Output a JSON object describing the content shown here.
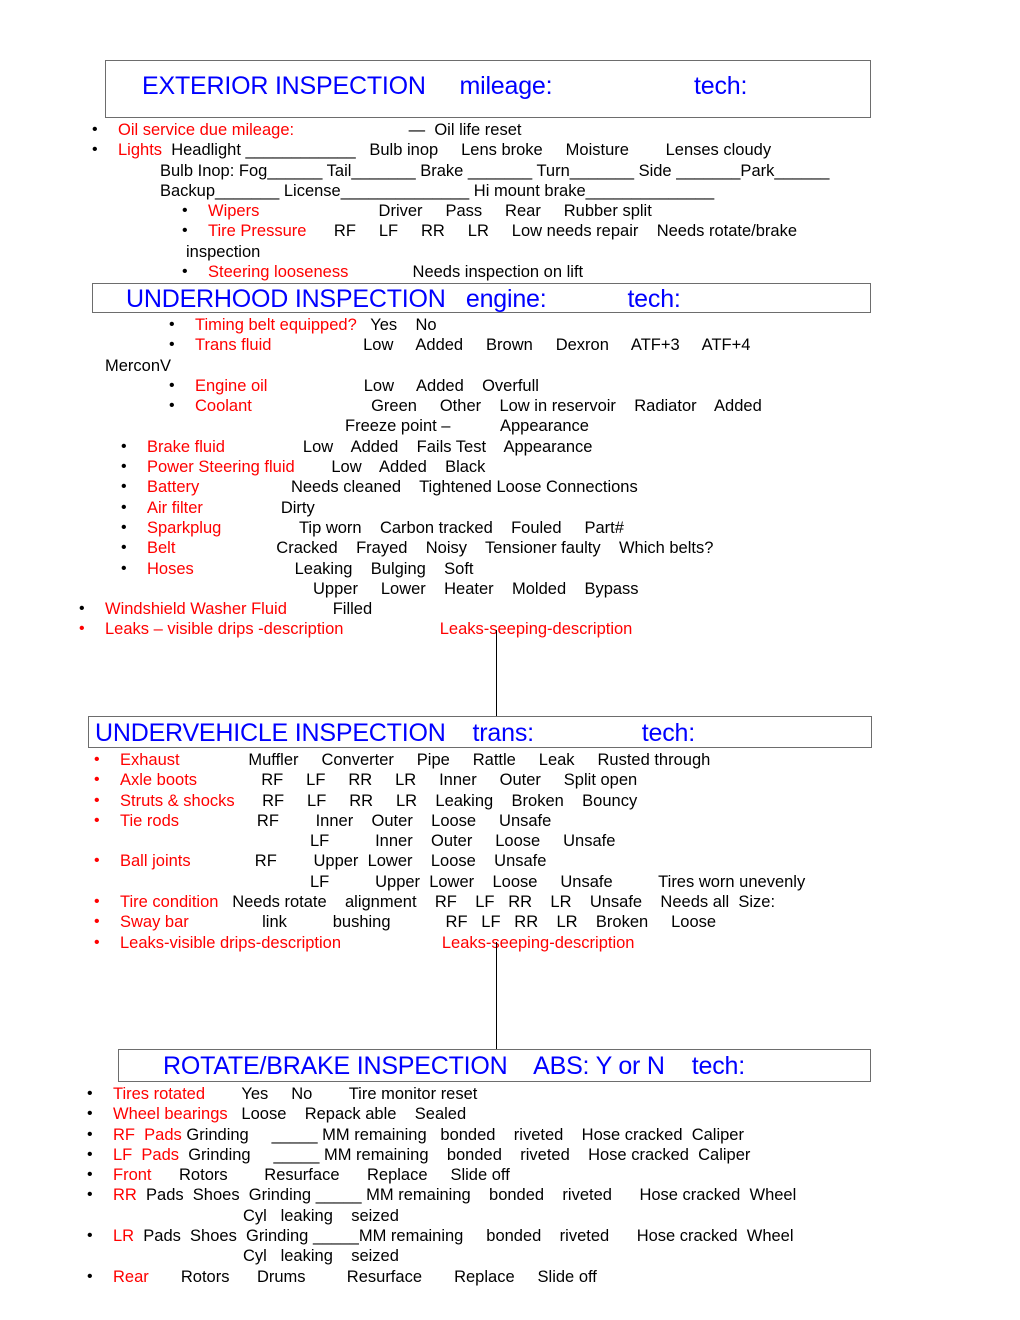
{
  "document": {
    "title": "Vehicle Inspection Checklist",
    "colors": {
      "heading": "#0000FF",
      "label": "#FF0000",
      "body": "#000000",
      "box_border": "#6D6D6D"
    }
  },
  "sections": [
    {
      "id": "exterior",
      "heading": "EXTERIOR INSPECTION     mileage:                     tech:",
      "heading_parts": {
        "name": "EXTERIOR INSPECTION",
        "field1_label": "mileage:",
        "field2_label": "tech:"
      },
      "lines": [
        {
          "bullet": "black",
          "indent": 0,
          "label": "Oil service due mileage:",
          "text": "                         —  Oil life reset"
        },
        {
          "bullet": "black",
          "indent": 0,
          "label": "Lights",
          "text": "  Headlight ____________   Bulb inop     Lens broke     Moisture        Lenses cloudy"
        },
        {
          "bullet": "none",
          "indent": 1,
          "label": "",
          "text": "Bulb Inop: Fog______ Tail_______ Brake _______ Turn_______ Side _______Park______"
        },
        {
          "bullet": "none",
          "indent": 1,
          "label": "",
          "text": "Backup_______ License______________ Hi mount brake______________"
        },
        {
          "bullet": "black",
          "indent": 2,
          "label": "Wipers",
          "text": "                          Driver     Pass     Rear     Rubber split"
        },
        {
          "bullet": "black",
          "indent": 2,
          "label": "Tire Pressure",
          "text": "      RF     LF     RR     LR     Low needs repair    Needs rotate/brake"
        },
        {
          "bullet": "none",
          "indent": 3,
          "label": "",
          "text": "inspection"
        },
        {
          "bullet": "black",
          "indent": 2,
          "label": "Steering looseness",
          "text": "              Needs inspection on lift"
        }
      ]
    },
    {
      "id": "underhood",
      "heading": "UNDERHOOD INSPECTION   engine:            tech:",
      "heading_parts": {
        "name": "UNDERHOOD INSPECTION",
        "field1_label": "engine:",
        "field2_label": "tech:"
      },
      "lines": [
        {
          "bullet": "black",
          "indent": 2,
          "label": "Timing belt equipped?",
          "text": "   Yes    No"
        },
        {
          "bullet": "black",
          "indent": 2,
          "label": "Trans fluid",
          "text": "                    Low     Added     Brown     Dexron     ATF+3     ATF+4"
        },
        {
          "bullet": "none",
          "indent": 4,
          "label": "",
          "text": "MerconV"
        },
        {
          "bullet": "black",
          "indent": 2,
          "label": "Engine oil",
          "text": "                     Low     Added    Overfull"
        },
        {
          "bullet": "black",
          "indent": 2,
          "label": "Coolant",
          "text": "                          Green     Other    Low in reservoir    Radiator    Added"
        },
        {
          "bullet": "none",
          "indent": 5,
          "label": "",
          "text": "Freeze point –           Appearance"
        },
        {
          "bullet": "black",
          "indent": 1,
          "label": "Brake fluid",
          "text": "                 Low    Added    Fails Test    Appearance"
        },
        {
          "bullet": "black",
          "indent": 1,
          "label": "Power Steering fluid",
          "text": "        Low    Added    Black"
        },
        {
          "bullet": "black",
          "indent": 1,
          "label": "Battery",
          "text": "                    Needs cleaned    Tightened Loose Connections"
        },
        {
          "bullet": "black",
          "indent": 1,
          "label": "Air filter",
          "text": "                 Dirty"
        },
        {
          "bullet": "black",
          "indent": 1,
          "label": "Sparkplug",
          "text": "                 Tip worn    Carbon tracked    Fouled     Part#"
        },
        {
          "bullet": "black",
          "indent": 1,
          "label": "Belt",
          "text": "                      Cracked    Frayed    Noisy    Tensioner faulty    Which belts?"
        },
        {
          "bullet": "black",
          "indent": 1,
          "label": "Hoses",
          "text": "                      Leaking    Bulging    Soft"
        },
        {
          "bullet": "none",
          "indent": 6,
          "label": "",
          "text": "Upper     Lower    Heater    Molded    Bypass"
        },
        {
          "bullet": "black",
          "indent": 0,
          "label": "Windshield Washer Fluid",
          "text": "          Filled"
        },
        {
          "bullet": "red",
          "indent": 0,
          "label": "Leaks – visible drips -description",
          "text": "",
          "label2": "Leaks-seeping-description",
          "label2_pad": "                     "
        }
      ]
    },
    {
      "id": "undervehicle",
      "heading": "UNDERVEHICLE INSPECTION    trans:                tech:",
      "heading_parts": {
        "name": "UNDERVEHICLE INSPECTION",
        "field1_label": "trans:",
        "field2_label": "tech:"
      },
      "lines": [
        {
          "bullet": "red",
          "indent": 0,
          "label": "Exhaust",
          "text": "               Muffler     Converter     Pipe     Rattle     Leak     Rusted through"
        },
        {
          "bullet": "red",
          "indent": 0,
          "label": "Axle boots",
          "text": "              RF     LF     RR     LR     Inner     Outer     Split open"
        },
        {
          "bullet": "red",
          "indent": 0,
          "label": "Struts & shocks",
          "text": "      RF     LF     RR     LR    Leaking    Broken    Bouncy"
        },
        {
          "bullet": "red",
          "indent": 0,
          "label": "Tie rods",
          "text": "                 RF        Inner    Outer    Loose     Unsafe"
        },
        {
          "bullet": "none",
          "indent": 7,
          "label": "",
          "text": "LF          Inner    Outer     Loose     Unsafe"
        },
        {
          "bullet": "red",
          "indent": 0,
          "label": "Ball joints",
          "text": "              RF        Upper  Lower    Loose    Unsafe"
        },
        {
          "bullet": "none",
          "indent": 7,
          "label": "",
          "text": "LF          Upper  Lower    Loose     Unsafe          Tires worn unevenly"
        },
        {
          "bullet": "red",
          "indent": 0,
          "label": "Tire condition",
          "text": "   Needs rotate    alignment    RF    LF   RR    LR    Unsafe    Needs all  Size:"
        },
        {
          "bullet": "red",
          "indent": 0,
          "label": "Sway bar",
          "text": "                link          bushing            RF   LF   RR    LR    Broken     Loose"
        },
        {
          "bullet": "red",
          "indent": 0,
          "label": "Leaks-visible drips-description",
          "text": "",
          "label2": "Leaks-seeping-description",
          "label2_pad": "                      "
        }
      ]
    },
    {
      "id": "rotate",
      "heading": "ROTATE/BRAKE INSPECTION    ABS: Y or N    tech:",
      "heading_parts": {
        "name": "ROTATE/BRAKE INSPECTION",
        "field1_label": "ABS: Y or N",
        "field2_label": "tech:"
      },
      "lines": [
        {
          "bullet": "black",
          "indent": 0,
          "label": "Tires rotated",
          "text": "        Yes     No        Tire monitor reset"
        },
        {
          "bullet": "black",
          "indent": 0,
          "label": "Wheel bearings",
          "text": "   Loose    Repack able    Sealed"
        },
        {
          "bullet": "black",
          "indent": 0,
          "label": "RF  Pads",
          "text": " Grinding     _____ MM remaining   bonded    riveted    Hose cracked  Caliper"
        },
        {
          "bullet": "black",
          "indent": 0,
          "label": "LF  Pads",
          "text": "  Grinding     _____ MM remaining    bonded    riveted    Hose cracked  Caliper"
        },
        {
          "bullet": "black",
          "indent": 0,
          "label": "Front",
          "text": "      Rotors        Resurface      Replace     Slide off"
        },
        {
          "bullet": "black",
          "indent": 0,
          "label": "RR",
          "text": "  Pads  Shoes  Grinding _____ MM remaining    bonded    riveted      Hose cracked  Wheel"
        },
        {
          "bullet": "none",
          "indent": 8,
          "label": "",
          "text": "Cyl   leaking    seized"
        },
        {
          "bullet": "black",
          "indent": 0,
          "label": "LR",
          "text": "  Pads  Shoes  Grinding _____MM remaining     bonded    riveted      Hose cracked  Wheel"
        },
        {
          "bullet": "none",
          "indent": 8,
          "label": "",
          "text": "Cyl   leaking    seized"
        },
        {
          "bullet": "black",
          "indent": 0,
          "label": "Rear",
          "text": "       Rotors      Drums         Resurface       Replace     Slide off"
        }
      ]
    }
  ]
}
